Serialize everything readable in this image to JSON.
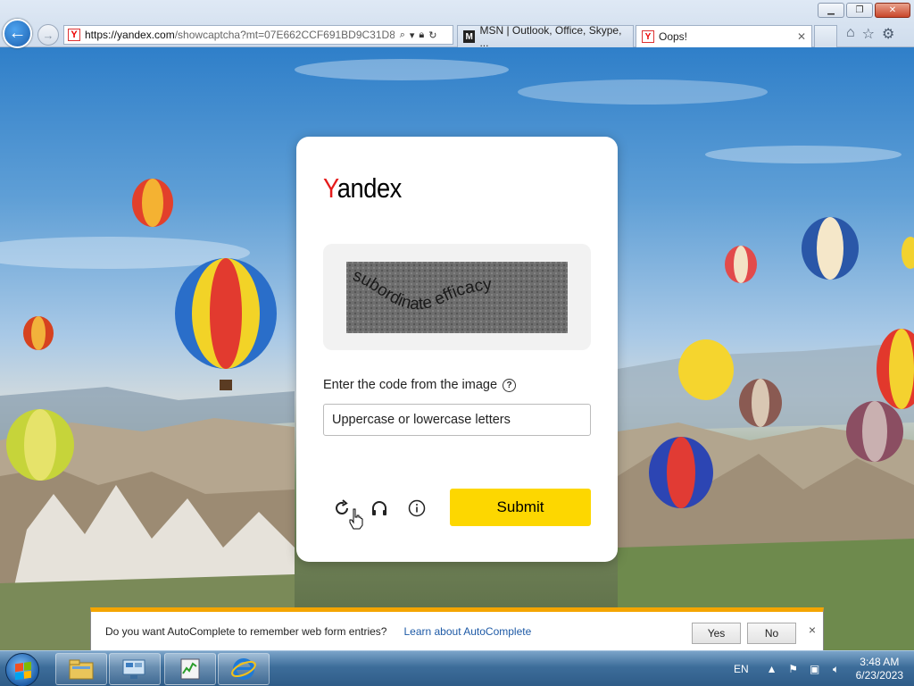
{
  "browser": {
    "url_host": "https://yandex.com",
    "url_rest": "/showcaptcha?mt=07E662CCF691BD9C31D8",
    "tabs": [
      {
        "title": "MSN | Outlook, Office, Skype, ...",
        "icon": "msn-icon",
        "active": false
      },
      {
        "title": "Oops!",
        "icon": "yandex-favicon",
        "active": true
      }
    ],
    "buttons": {
      "back": "back-arrow-icon",
      "forward": "forward-arrow-icon"
    },
    "window_controls": [
      "minimize",
      "restore",
      "close"
    ],
    "toolbar_icons": [
      "home-icon",
      "star-icon",
      "gear-icon"
    ]
  },
  "card": {
    "logo_y": "Y",
    "logo_rest": "andex",
    "captcha_text": "subordinate efficacy",
    "field_label": "Enter the code from the image",
    "input_placeholder": "Uppercase or lowercase letters",
    "submit_label": "Submit",
    "actions": [
      "refresh-icon",
      "audio-icon",
      "info-icon"
    ]
  },
  "autocomplete_bar": {
    "question": "Do you want AutoComplete to remember web form entries?",
    "link": "Learn about AutoComplete",
    "yes": "Yes",
    "no": "No",
    "close": "×"
  },
  "taskbar": {
    "language": "EN",
    "time": "3:48 AM",
    "date": "6/23/2023",
    "pinned": [
      "file-explorer-icon",
      "server-manager-icon",
      "task-manager-icon",
      "internet-explorer-icon"
    ]
  },
  "colors": {
    "yandex_red": "#e51b1b",
    "submit_yellow": "#fdd700",
    "notification_orange": "#f4a500",
    "link_blue": "#1e5aa6"
  }
}
